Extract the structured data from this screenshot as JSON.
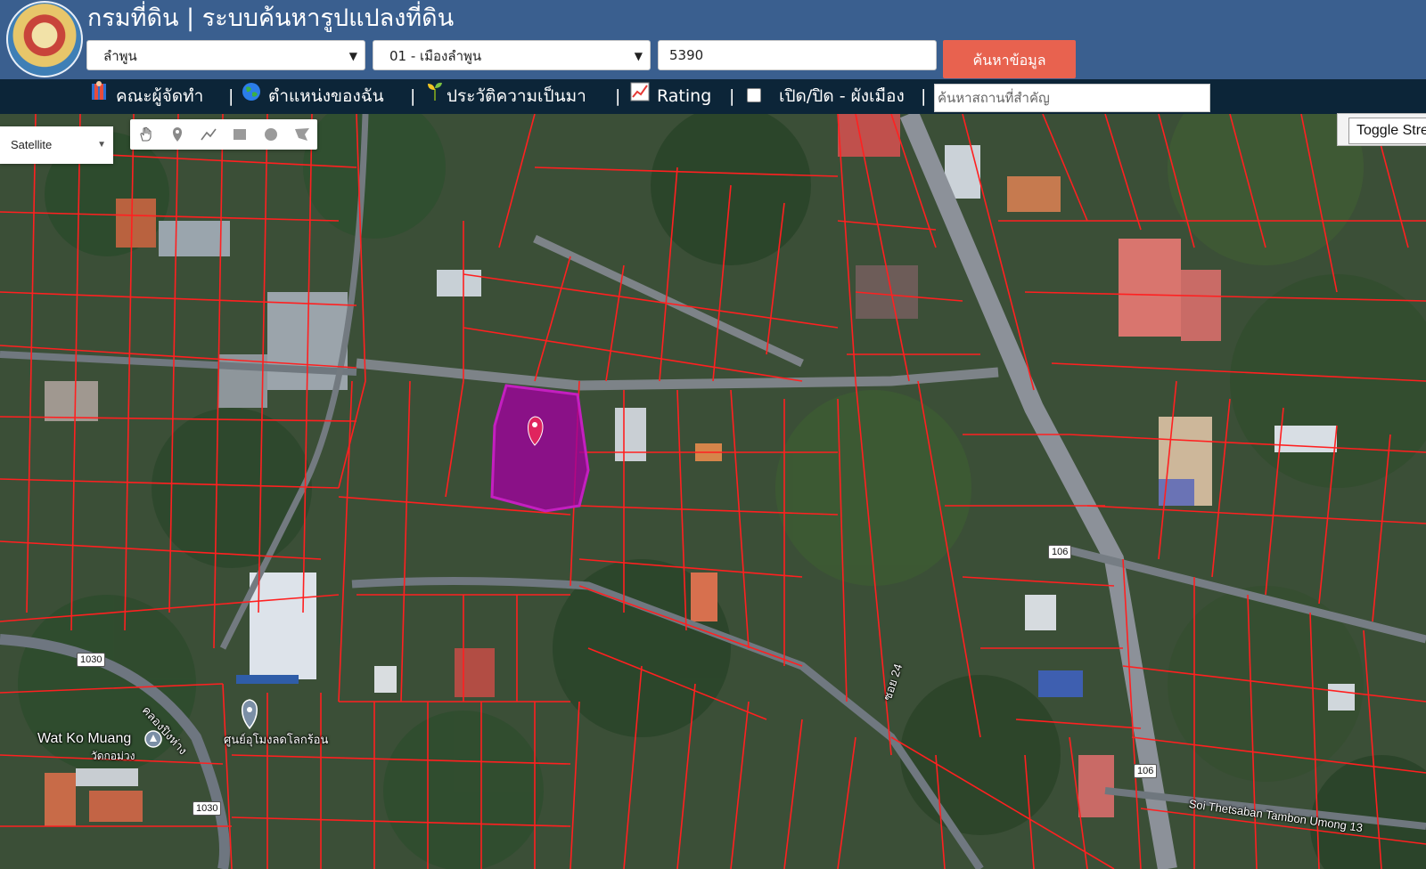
{
  "header": {
    "title": "กรมที่ดิน | ระบบค้นหารูปแปลงที่ดิน",
    "province_value": "ลำพูน",
    "district_value": "01 - เมืองลำพูน",
    "parcel_value": "5390",
    "search_button_label": "ค้นหาข้อมูล"
  },
  "nav": {
    "items": [
      {
        "label": "คณะผู้จัดทำ",
        "icon": "team-icon"
      },
      {
        "label": "ตำแหน่งของฉัน",
        "icon": "globe-icon"
      },
      {
        "label": "ประวัติความเป็นมา",
        "icon": "sprout-icon"
      },
      {
        "label": "Rating",
        "icon": "chart-icon"
      },
      {
        "label": "เปิด/ปิด - ผังเมือง",
        "icon": "checkbox-icon"
      }
    ],
    "separator": "|",
    "place_search_placeholder": "ค้นหาสถานที่สำคัญ"
  },
  "map": {
    "map_type": "Satellite",
    "toggle_street_label": "Toggle Street View",
    "tools": [
      "hand-icon",
      "marker-icon",
      "polyline-icon",
      "rectangle-icon",
      "circle-icon",
      "polygon-icon"
    ],
    "labels": {
      "wat_ko_muang": "Wat Ko Muang",
      "wat_ko_muang_th": "วัดกอม่วง",
      "klong": "คลองปิงห่าง",
      "center": "ศูนย์อุโมงลดโลกร้อน",
      "soi24": "ซอย 24",
      "soi_thetsaban": "Soi Thetsaban Tambon Umong 13"
    },
    "shields": {
      "r1030_a": "1030",
      "r1030_b": "1030",
      "r106_a": "106",
      "r106_b": "106"
    },
    "colors": {
      "parcel_lines": "#ff2020",
      "selected_parcel": "#a0009e",
      "marker": "#e0245e"
    }
  }
}
